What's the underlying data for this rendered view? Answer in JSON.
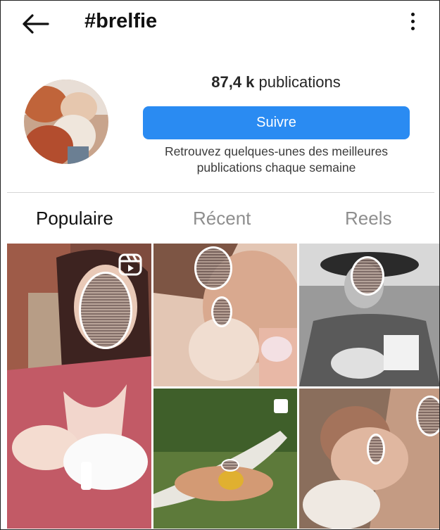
{
  "header": {
    "title": "#brelfie"
  },
  "profile": {
    "count_number": "87,4 k",
    "count_label": "publications",
    "follow_label": "Suivre",
    "tagline": "Retrouvez quelques-unes des meilleures publications chaque semaine"
  },
  "tabs": [
    {
      "label": "Populaire",
      "active": true
    },
    {
      "label": "Récent",
      "active": false
    },
    {
      "label": "Reels",
      "active": false
    }
  ],
  "colors": {
    "accent": "#2a8bf2",
    "text": "#262626",
    "muted": "#8e8e8e"
  },
  "icons": [
    "back-arrow-icon",
    "more-vertical-icon",
    "reels-icon",
    "multi-photo-icon"
  ]
}
